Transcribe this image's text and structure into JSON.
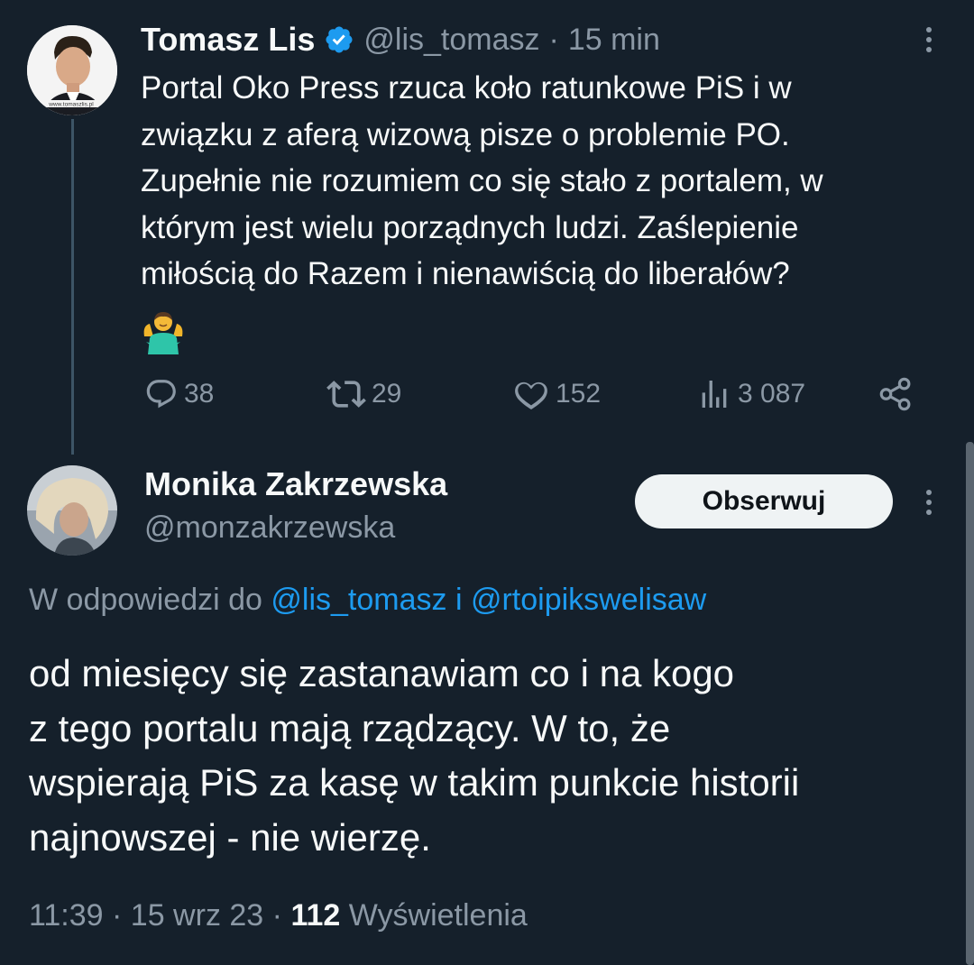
{
  "parent_tweet": {
    "author_name": "Tomasz Lis",
    "handle": "@lis_tomasz",
    "separator": "·",
    "time": "15 min",
    "avatar_caption": "www.tomaszlis.pl",
    "text": "Portal Oko Press rzuca koło ratunkowe PiS i w\nzwiązku z aferą wizową pisze o problemie PO.\nZupełnie nie rozumiem co się  stało z portalem, w\nktórym jest wielu porządnych ludzi. Zaślepienie\nmiłością do Razem i nienawiścią do liberałów?",
    "emoji": "person-shrugging",
    "stats": {
      "replies": "38",
      "retweets": "29",
      "likes": "152",
      "views": "3 087"
    }
  },
  "reply_tweet": {
    "author_name": "Monika Zakrzewska",
    "handle": "@monzakrzewska",
    "follow_label": "Obserwuj",
    "reply_prefix": "W odpowiedzi do",
    "reply_user1": "@lis_tomasz",
    "reply_joiner": "i",
    "reply_user2": "@rtoipikswelisaw",
    "text": "od miesięcy się zastanawiam co i na kogo\nz tego portalu mają rządzący. W to, że\nwspierają PiS za kasę w takim punkcie historii\nnajnowszej - nie wierzę.",
    "time": "11:39",
    "date": "15 wrz 23",
    "sep": "·",
    "views_count": "112",
    "views_label": "Wyświetlenia"
  },
  "colors": {
    "background": "#15202b",
    "text": "#f7f9f9",
    "secondary": "#8b98a5",
    "accent": "#1d9bf0"
  }
}
